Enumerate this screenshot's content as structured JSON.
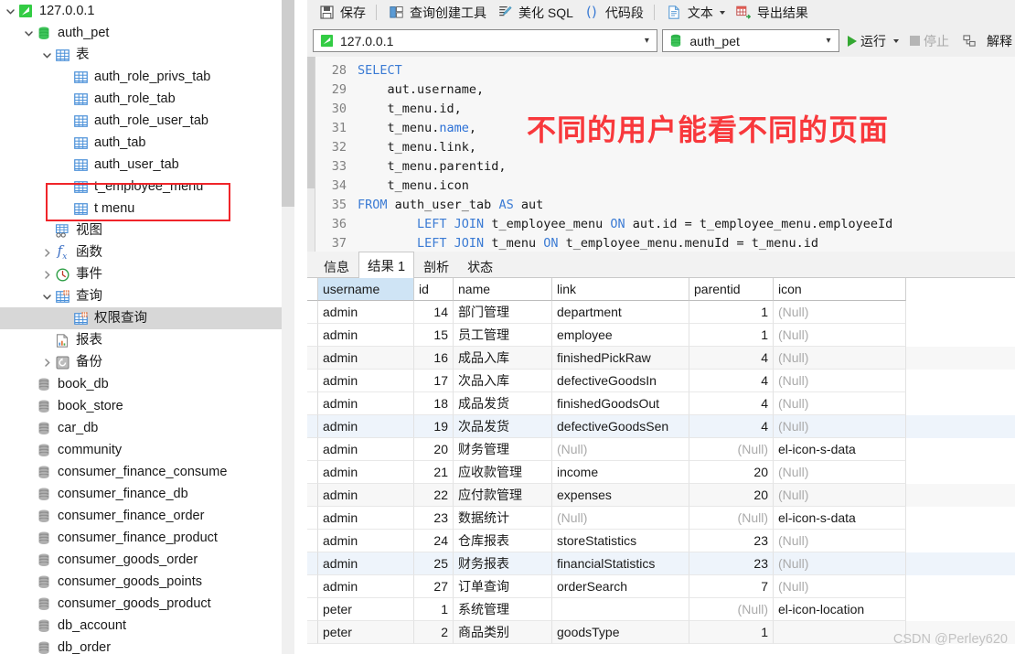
{
  "toolbar": {
    "buttons": [
      {
        "label": "保存",
        "icon": "save-icon"
      },
      {
        "label": "查询创建工具",
        "icon": "query-builder-icon"
      },
      {
        "label": "美化 SQL",
        "icon": "beautify-sql-icon"
      },
      {
        "label": "代码段",
        "icon": "code-snippet-icon"
      },
      {
        "label": "文本",
        "icon": "text-icon",
        "caret": true
      },
      {
        "label": "导出结果",
        "icon": "export-result-icon"
      }
    ],
    "host_value": "127.0.0.1",
    "database_value": "auth_pet",
    "run_label": "运行",
    "stop_label": "停止",
    "explain_label": "解释"
  },
  "editor": {
    "annotation": "不同的用户能看不同的页面",
    "lines": [
      {
        "num": "28",
        "tokens": [
          {
            "t": "SELECT",
            "c": "kw"
          }
        ]
      },
      {
        "num": "29",
        "tokens": [
          {
            "t": "    aut.username,",
            "c": "plain"
          }
        ]
      },
      {
        "num": "30",
        "tokens": [
          {
            "t": "    t_menu.id,",
            "c": "plain"
          }
        ]
      },
      {
        "num": "31",
        "tokens": [
          {
            "t": "    t_menu.",
            "c": "plain"
          },
          {
            "t": "name",
            "c": "col"
          },
          {
            "t": ",",
            "c": "plain"
          }
        ]
      },
      {
        "num": "32",
        "tokens": [
          {
            "t": "    t_menu.link,",
            "c": "plain"
          }
        ]
      },
      {
        "num": "33",
        "tokens": [
          {
            "t": "    t_menu.parentid,",
            "c": "plain"
          }
        ]
      },
      {
        "num": "34",
        "tokens": [
          {
            "t": "    t_menu.icon",
            "c": "plain"
          }
        ]
      },
      {
        "num": "35",
        "tokens": [
          {
            "t": "FROM",
            "c": "kw"
          },
          {
            "t": " auth_user_tab ",
            "c": "plain"
          },
          {
            "t": "AS",
            "c": "kw"
          },
          {
            "t": " aut",
            "c": "plain"
          }
        ]
      },
      {
        "num": "36",
        "tokens": [
          {
            "t": "        ",
            "c": "plain"
          },
          {
            "t": "LEFT JOIN",
            "c": "kw"
          },
          {
            "t": " t_employee_menu ",
            "c": "plain"
          },
          {
            "t": "ON",
            "c": "kw"
          },
          {
            "t": " aut.id = t_employee_menu.employeeId",
            "c": "plain"
          }
        ]
      },
      {
        "num": "37",
        "tokens": [
          {
            "t": "        ",
            "c": "plain"
          },
          {
            "t": "LEFT JOIN",
            "c": "kw"
          },
          {
            "t": " t_menu ",
            "c": "plain"
          },
          {
            "t": "ON",
            "c": "kw"
          },
          {
            "t": " t_employee_menu.menuId = t_menu.id",
            "c": "plain"
          }
        ]
      },
      {
        "num": "38",
        "tokens": [
          {
            "t": "",
            "c": "plain"
          }
        ]
      }
    ]
  },
  "result_tabs": [
    {
      "label": "信息",
      "active": false
    },
    {
      "label": "结果 1",
      "active": true
    },
    {
      "label": "剖析",
      "active": false
    },
    {
      "label": "状态",
      "active": false
    }
  ],
  "grid": {
    "columns": [
      {
        "key": "username",
        "label": "username",
        "cls": "c-username",
        "selected": true
      },
      {
        "key": "id",
        "label": "id",
        "cls": "c-id",
        "align": "num"
      },
      {
        "key": "name",
        "label": "name",
        "cls": "c-name"
      },
      {
        "key": "link",
        "label": "link",
        "cls": "c-link"
      },
      {
        "key": "parentid",
        "label": "parentid",
        "cls": "c-parentid",
        "align": "num"
      },
      {
        "key": "icon",
        "label": "icon",
        "cls": "c-icon"
      }
    ],
    "null_text": "(Null)",
    "rows": [
      {
        "username": "admin",
        "id": "14",
        "name": "部门管理",
        "link": "department",
        "parentid": "1",
        "icon": null
      },
      {
        "username": "admin",
        "id": "15",
        "name": "员工管理",
        "link": "employee",
        "parentid": "1",
        "icon": null
      },
      {
        "username": "admin",
        "id": "16",
        "name": "成品入库",
        "link": "finishedPickRaw",
        "parentid": "4",
        "icon": null
      },
      {
        "username": "admin",
        "id": "17",
        "name": "次品入库",
        "link": "defectiveGoodsIn",
        "parentid": "4",
        "icon": null
      },
      {
        "username": "admin",
        "id": "18",
        "name": "成品发货",
        "link": "finishedGoodsOut",
        "parentid": "4",
        "icon": null
      },
      {
        "username": "admin",
        "id": "19",
        "name": "次品发货",
        "link": "defectiveGoodsSen",
        "parentid": "4",
        "icon": null
      },
      {
        "username": "admin",
        "id": "20",
        "name": "财务管理",
        "link": null,
        "parentid": null,
        "icon": "el-icon-s-data"
      },
      {
        "username": "admin",
        "id": "21",
        "name": "应收款管理",
        "link": "income",
        "parentid": "20",
        "icon": null
      },
      {
        "username": "admin",
        "id": "22",
        "name": "应付款管理",
        "link": "expenses",
        "parentid": "20",
        "icon": null
      },
      {
        "username": "admin",
        "id": "23",
        "name": "数据统计",
        "link": null,
        "parentid": null,
        "icon": "el-icon-s-data"
      },
      {
        "username": "admin",
        "id": "24",
        "name": "仓库报表",
        "link": "storeStatistics",
        "parentid": "23",
        "icon": null
      },
      {
        "username": "admin",
        "id": "25",
        "name": "财务报表",
        "link": "financialStatistics",
        "parentid": "23",
        "icon": null
      },
      {
        "username": "admin",
        "id": "27",
        "name": "订单查询",
        "link": "orderSearch",
        "parentid": "7",
        "icon": null
      },
      {
        "username": "peter",
        "id": "1",
        "name": "系统管理",
        "link": "",
        "parentid": null,
        "icon": "el-icon-location"
      },
      {
        "username": "peter",
        "id": "2",
        "name": "商品类别",
        "link": "goodsType",
        "parentid": "1",
        "icon": ""
      }
    ]
  },
  "sidebar": {
    "items": [
      {
        "label": "127.0.0.1",
        "indent": 0,
        "twisty": "down",
        "icon": "connection-icon"
      },
      {
        "label": "auth_pet",
        "indent": 1,
        "twisty": "down",
        "icon": "database-icon"
      },
      {
        "label": "表",
        "indent": 2,
        "twisty": "down",
        "icon": "table-folder-icon"
      },
      {
        "label": "auth_role_privs_tab",
        "indent": 3,
        "twisty": "none",
        "icon": "table-icon"
      },
      {
        "label": "auth_role_tab",
        "indent": 3,
        "twisty": "none",
        "icon": "table-icon"
      },
      {
        "label": "auth_role_user_tab",
        "indent": 3,
        "twisty": "none",
        "icon": "table-icon"
      },
      {
        "label": "auth_tab",
        "indent": 3,
        "twisty": "none",
        "icon": "table-icon"
      },
      {
        "label": "auth_user_tab",
        "indent": 3,
        "twisty": "none",
        "icon": "table-icon"
      },
      {
        "label": "t_employee_menu",
        "indent": 3,
        "twisty": "none",
        "icon": "table-icon"
      },
      {
        "label": "t menu",
        "indent": 3,
        "twisty": "none",
        "icon": "table-icon"
      },
      {
        "label": "视图",
        "indent": 2,
        "twisty": "none",
        "icon": "view-icon"
      },
      {
        "label": "函数",
        "indent": 2,
        "twisty": "right",
        "icon": "function-icon"
      },
      {
        "label": "事件",
        "indent": 2,
        "twisty": "right",
        "icon": "event-icon"
      },
      {
        "label": "查询",
        "indent": 2,
        "twisty": "down",
        "icon": "query-icon"
      },
      {
        "label": "权限查询",
        "indent": 3,
        "twisty": "none",
        "icon": "query-icon",
        "selected": true
      },
      {
        "label": "报表",
        "indent": 2,
        "twisty": "none",
        "icon": "report-icon"
      },
      {
        "label": "备份",
        "indent": 2,
        "twisty": "right",
        "icon": "backup-icon"
      },
      {
        "label": "book_db",
        "indent": 1,
        "twisty": "none",
        "icon": "database-gray-icon"
      },
      {
        "label": "book_store",
        "indent": 1,
        "twisty": "none",
        "icon": "database-gray-icon"
      },
      {
        "label": "car_db",
        "indent": 1,
        "twisty": "none",
        "icon": "database-gray-icon"
      },
      {
        "label": "community",
        "indent": 1,
        "twisty": "none",
        "icon": "database-gray-icon"
      },
      {
        "label": "consumer_finance_consume",
        "indent": 1,
        "twisty": "none",
        "icon": "database-gray-icon"
      },
      {
        "label": "consumer_finance_db",
        "indent": 1,
        "twisty": "none",
        "icon": "database-gray-icon"
      },
      {
        "label": "consumer_finance_order",
        "indent": 1,
        "twisty": "none",
        "icon": "database-gray-icon"
      },
      {
        "label": "consumer_finance_product",
        "indent": 1,
        "twisty": "none",
        "icon": "database-gray-icon"
      },
      {
        "label": "consumer_goods_order",
        "indent": 1,
        "twisty": "none",
        "icon": "database-gray-icon"
      },
      {
        "label": "consumer_goods_points",
        "indent": 1,
        "twisty": "none",
        "icon": "database-gray-icon"
      },
      {
        "label": "consumer_goods_product",
        "indent": 1,
        "twisty": "none",
        "icon": "database-gray-icon"
      },
      {
        "label": "db_account",
        "indent": 1,
        "twisty": "none",
        "icon": "database-gray-icon"
      },
      {
        "label": "db_order",
        "indent": 1,
        "twisty": "none",
        "icon": "database-gray-icon"
      }
    ]
  },
  "watermark": "CSDN @Perley620",
  "colors": {
    "annotation_red": "#f8383c",
    "selected_column": "#cfe4f5",
    "run_green": "#34a832"
  }
}
